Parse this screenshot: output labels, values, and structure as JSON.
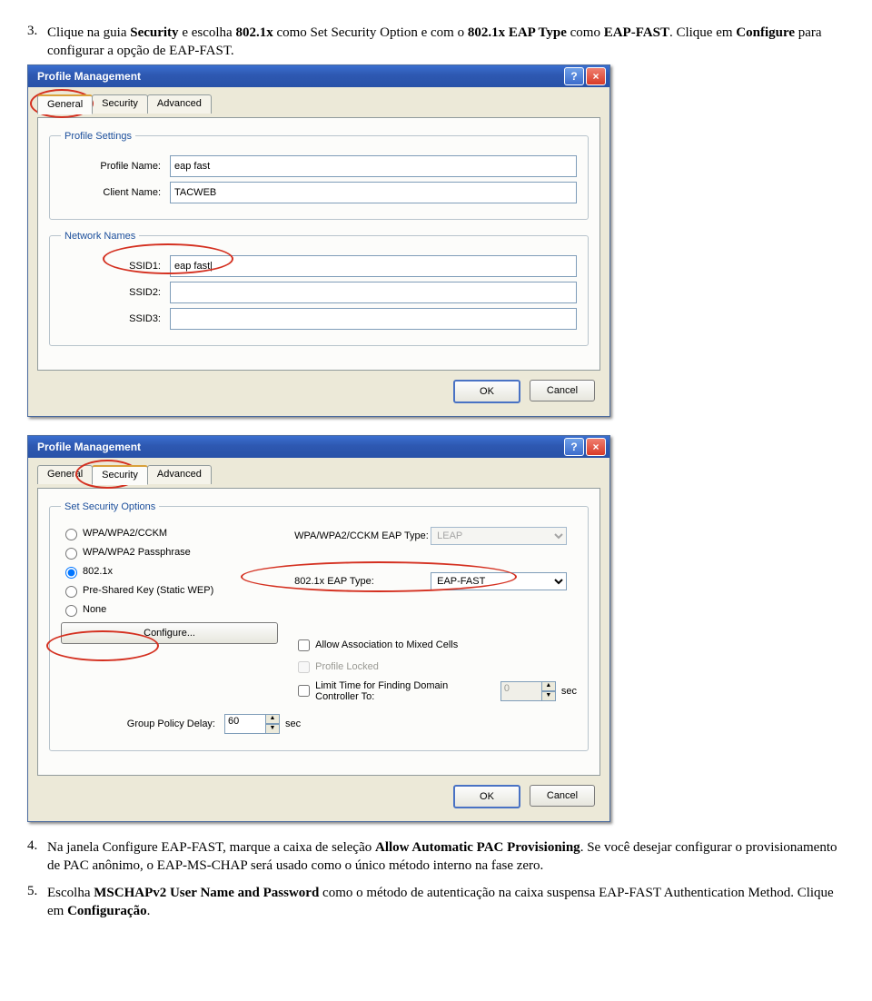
{
  "steps": {
    "s3num": "3.",
    "s3a": "Clique na guia ",
    "s3b1": "Security",
    "s3c": " e escolha ",
    "s3b2": "802.1x",
    "s3d": " como Set Security Option e com o ",
    "s3b3": "802.1x EAP Type",
    "s3e": " como ",
    "s3b4": "EAP-FAST",
    "s3f": ". Clique em ",
    "s3b5": "Configure",
    "s3g": " para configurar a opção de EAP-FAST.",
    "s4num": "4.",
    "s4a": "Na janela Configure EAP-FAST, marque a caixa de seleção ",
    "s4b1": "Allow Automatic PAC Provisioning",
    "s4c": ". Se você desejar configurar o provisionamento de PAC anônimo, o EAP-MS-CHAP será usado como o único método interno na fase zero.",
    "s5num": "5.",
    "s5a": "Escolha ",
    "s5b1": "MSCHAPv2 User Name and Password",
    "s5c": " como o método de autenticação na caixa suspensa EAP-FAST Authentication Method. Clique em ",
    "s5b2": "Configuração",
    "s5d": "."
  },
  "win": {
    "title": "Profile Management",
    "help": "?",
    "close": "×",
    "tabs": {
      "general": "General",
      "security": "Security",
      "advanced": "Advanced"
    },
    "buttons": {
      "ok": "OK",
      "cancel": "Cancel"
    }
  },
  "general": {
    "group1": "Profile Settings",
    "profileName_lbl": "Profile Name:",
    "profileName_val": "eap fast",
    "clientName_lbl": "Client Name:",
    "clientName_val": "TACWEB",
    "group2": "Network Names",
    "ssid1_lbl": "SSID1:",
    "ssid1_val": "eap fast|",
    "ssid2_lbl": "SSID2:",
    "ssid2_val": "",
    "ssid3_lbl": "SSID3:",
    "ssid3_val": ""
  },
  "security": {
    "group": "Set Security Options",
    "opt1": "WPA/WPA2/CCKM",
    "opt2": "WPA/WPA2 Passphrase",
    "opt3": "802.1x",
    "opt4": "Pre-Shared Key (Static WEP)",
    "opt5": "None",
    "eap1_lbl": "WPA/WPA2/CCKM EAP Type:",
    "eap1_val": "LEAP",
    "eap2_lbl": "802.1x EAP Type:",
    "eap2_val": "EAP-FAST",
    "configure": "Configure...",
    "chk1": "Allow Association to Mixed Cells",
    "chk2": "Profile Locked",
    "chk3": "Limit Time for Finding Domain Controller To:",
    "chk3val": "0",
    "chk3unit": "sec",
    "gpd_lbl": "Group Policy Delay:",
    "gpd_val": "60",
    "gpd_unit": "sec"
  }
}
